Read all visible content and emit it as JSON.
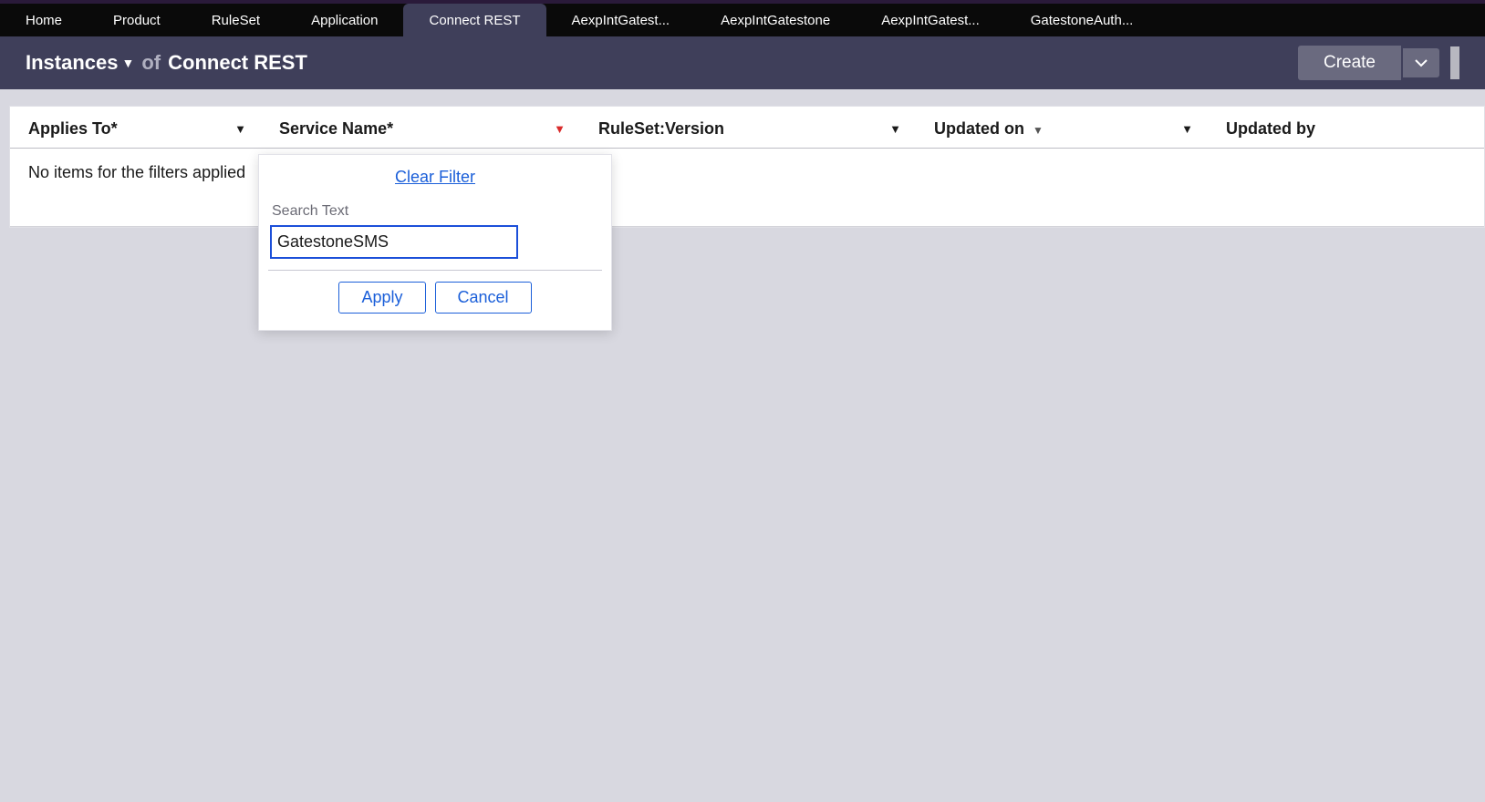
{
  "tabs": [
    {
      "label": "Home",
      "active": false
    },
    {
      "label": "Product",
      "active": false
    },
    {
      "label": "RuleSet",
      "active": false
    },
    {
      "label": "Application",
      "active": false
    },
    {
      "label": "Connect REST",
      "active": true
    },
    {
      "label": "AexpIntGatest...",
      "active": false
    },
    {
      "label": "AexpIntGatestone",
      "active": false
    },
    {
      "label": "AexpIntGatest...",
      "active": false
    },
    {
      "label": "GatestoneAuth...",
      "active": false
    }
  ],
  "subheader": {
    "instances_label": "Instances",
    "of_label": "of",
    "type_label": "Connect REST",
    "create_label": "Create"
  },
  "columns": {
    "c1": "Applies To*",
    "c2": "Service Name*",
    "c3": "RuleSet:Version",
    "c4": "Updated on",
    "c5": "Updated by"
  },
  "empty_message": "No items for the filters applied",
  "popover": {
    "clear_filter": "Clear Filter",
    "search_label": "Search Text",
    "search_value": "GatestoneSMS",
    "apply": "Apply",
    "cancel": "Cancel"
  }
}
